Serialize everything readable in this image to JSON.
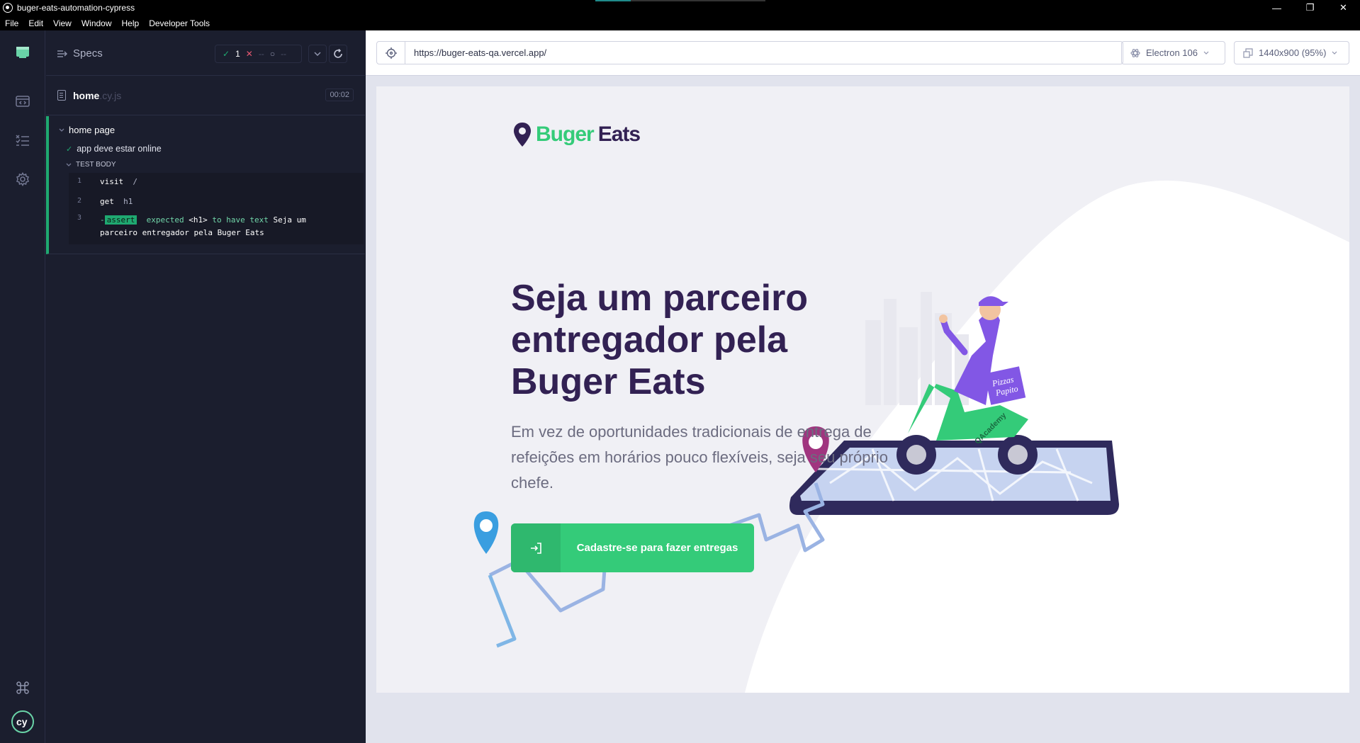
{
  "window": {
    "title": "buger-eats-automation-cypress",
    "minimize": "—",
    "restore": "❐",
    "close": "✕"
  },
  "menu": [
    "File",
    "Edit",
    "View",
    "Window",
    "Help",
    "Developer Tools"
  ],
  "reporter": {
    "specs_label": "Specs",
    "passed": "1",
    "failed": "--",
    "pending": "--",
    "file_name": "home",
    "file_ext": ".cy.js",
    "duration": "00:02",
    "suite_title": "home page",
    "test_title": "app deve estar online",
    "body_label": "TEST BODY",
    "commands": [
      {
        "num": "1",
        "name": "visit",
        "message": "/"
      },
      {
        "num": "2",
        "name": "get",
        "message": "h1"
      },
      {
        "num": "3",
        "name": "assert",
        "prefix": "-",
        "parts": [
          "expected",
          "<h1>",
          "to have text",
          "Seja um parceiro entregador pela Buger Eats"
        ]
      }
    ]
  },
  "aut": {
    "url": "https://buger-eats-qa.vercel.app/",
    "browser": "Electron 106",
    "viewport": "1440x900 (95%)"
  },
  "page": {
    "logo_part1": "Buger",
    "logo_part2": "Eats",
    "hero_title": "Seja um parceiro entregador pela Buger Eats",
    "hero_text": "Em vez de oportunidades tradicionais de entrega de refeições em horários pouco flexíveis, seja seu próprio chefe.",
    "cta_label": "Cadastre-se para fazer entregas",
    "box_text_1": "Pizzas",
    "box_text_2": "Papito",
    "scooter_text": "QAcademy"
  },
  "colors": {
    "brand_green": "#34cb79",
    "brand_purple": "#322153",
    "pass": "#1fa971",
    "fail": "#e45770"
  }
}
